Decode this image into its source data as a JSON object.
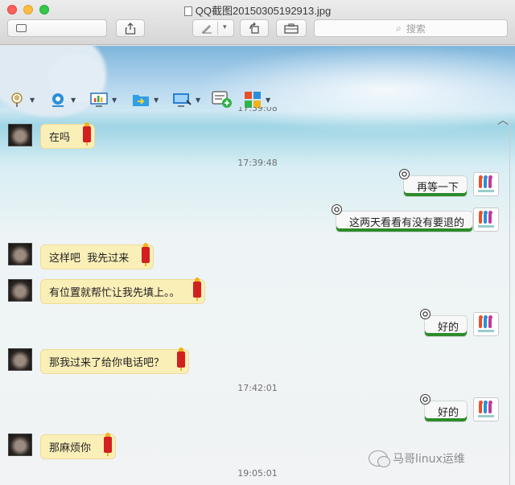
{
  "window": {
    "title": "QQ截图20150305192913.jpg"
  },
  "toolbar": {
    "search_placeholder": "搜索",
    "search_icon": "magnifier-icon",
    "buttons": [
      "sidebar-icon",
      "share-icon",
      "markup-pen-icon",
      "rotate-icon",
      "toolbox-icon"
    ]
  },
  "chat_toolbar": {
    "tools": [
      "mic-icon",
      "video-call-icon",
      "screen-share-icon",
      "send-file-icon",
      "remote-assist-icon",
      "add-note-icon",
      "apps-icon"
    ]
  },
  "chat": {
    "partial_time": "17:39:08",
    "messages": [
      {
        "side": "left",
        "text": "在吗"
      },
      {
        "side": "time",
        "text": "17:39:48"
      },
      {
        "side": "right",
        "text": "再等一下"
      },
      {
        "side": "right",
        "text": "这两天看看有没有要退的"
      },
      {
        "side": "left",
        "text": "这样吧  我先过来"
      },
      {
        "side": "left",
        "text": "有位置就帮忙让我先填上。。"
      },
      {
        "side": "right",
        "text": "好的"
      },
      {
        "side": "left",
        "text": "那我过来了给你电话吧？"
      },
      {
        "side": "time",
        "text": "17:42:01"
      },
      {
        "side": "right",
        "text": "好的"
      },
      {
        "side": "left",
        "text": "那麻烦你"
      },
      {
        "side": "time",
        "text": "19:05:01"
      }
    ]
  },
  "watermark": {
    "text": "马哥linux运维"
  },
  "colors": {
    "left_bubble": "#fbefb8",
    "right_bubble_underline": "#2e8b2a",
    "lantern": "#d3201f"
  }
}
